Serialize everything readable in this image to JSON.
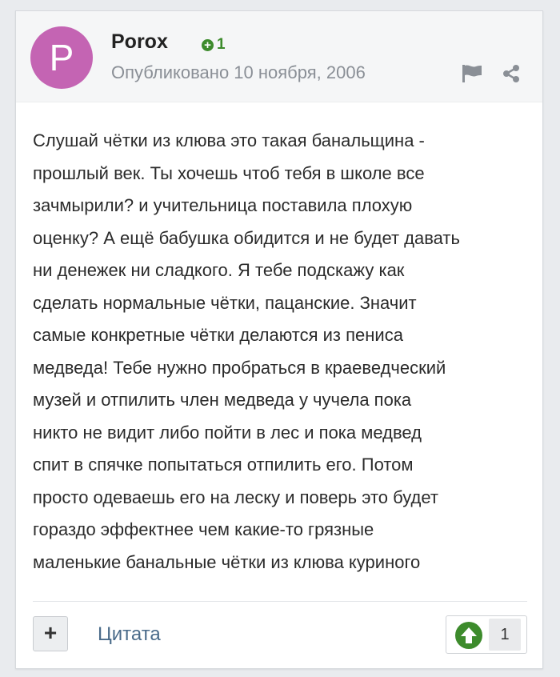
{
  "post": {
    "avatar_letter": "P",
    "author": "Porox",
    "reputation": "1",
    "published": "Опубликовано 10 ноября, 2006",
    "lines": [
      "Слушай чётки из клюва это такая банальщина -",
      "прошлый век. Ты хочешь чтоб тебя в школе все",
      "зачмырили? и учительница поставила плохую",
      "оценку? А ещё бабушка обидится и не будет давать",
      "ни денежек ни сладкого. Я тебе подскажу как",
      "сделать нормальные чётки, пацанские. Значит",
      "самые конкретные чётки делаются из пениса",
      "медведа! Тебе нужно пробраться в краеведческий",
      "музей и отпилить член медведа у чучела пока",
      "никто не видит либо пойти в лес и пока медвед",
      "спит в спячке попытаться отпилить его. Потом",
      "просто одеваешь его на леску и поверь это будет",
      "гораздо эффектнее чем какие-то грязные",
      "маленькие банальные чётки из клюва куриного"
    ]
  },
  "footer": {
    "plus_label": "+",
    "quote_label": "Цитата",
    "vote_count": "1"
  },
  "icons": {
    "flag": "flag-icon",
    "share": "share-icon",
    "upvote": "arrow-up-icon"
  },
  "colors": {
    "avatar": "#c464b3",
    "reputation": "#3d8b2c",
    "upvote": "#3d8b2c",
    "link": "#4a6b8a"
  }
}
